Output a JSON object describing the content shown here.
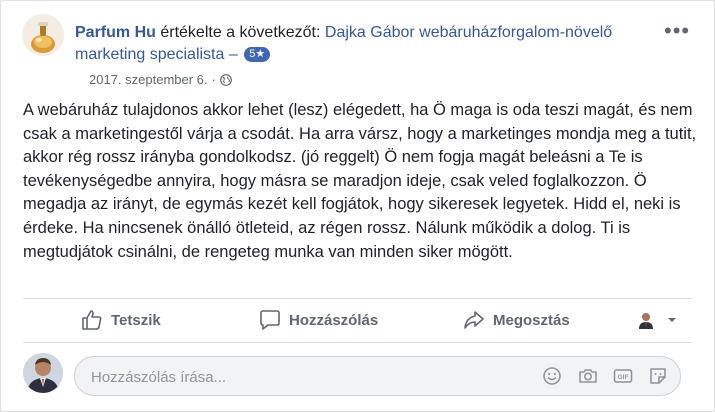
{
  "post": {
    "author": "Parfum Hu",
    "action_text": "értékelte a következőt:",
    "target": "Dajka Gábor webáruházforgalom-növelő marketing specialista –",
    "rating": "5★",
    "date": "2017. szeptember 6.",
    "separator": "·",
    "body": "A webáruház tulajdonos akkor lehet (lesz) elégedett, ha Ö maga is oda teszi magát, és nem csak a marketingestől várja a csodát. Ha arra vársz, hogy a marketinges mondja meg a tutit, akkor rég rossz irányba gondolkodsz. (jó reggelt) Ö nem fogja magát beleásni a Te is tevékenységedbe annyira, hogy másra se maradjon ideje, csak veled foglalkozzon. Ö megadja az irányt, de egymás kezét kell fogjátok, hogy sikeresek legyetek. Hidd el, neki is érdeke. Ha nincsenek önálló ötleteid, az régen rossz. Nálunk működik a dolog. Ti is megtudjátok csinálni, de rengeteg munka van minden siker mögött."
  },
  "actions": {
    "like": "Tetszik",
    "comment": "Hozzászólás",
    "share": "Megosztás"
  },
  "comment": {
    "placeholder": "Hozzászólás írása..."
  },
  "icons": {
    "more": "more-options-icon",
    "privacy": "globe-icon",
    "like": "thumbs-up-icon",
    "comment": "speech-bubble-icon",
    "share": "share-arrow-icon",
    "emoji": "smiley-icon",
    "camera": "camera-icon",
    "gif": "gif-icon",
    "sticker": "sticker-icon"
  },
  "colors": {
    "link": "#365899",
    "badge": "#4267b2",
    "muted": "#606770"
  }
}
